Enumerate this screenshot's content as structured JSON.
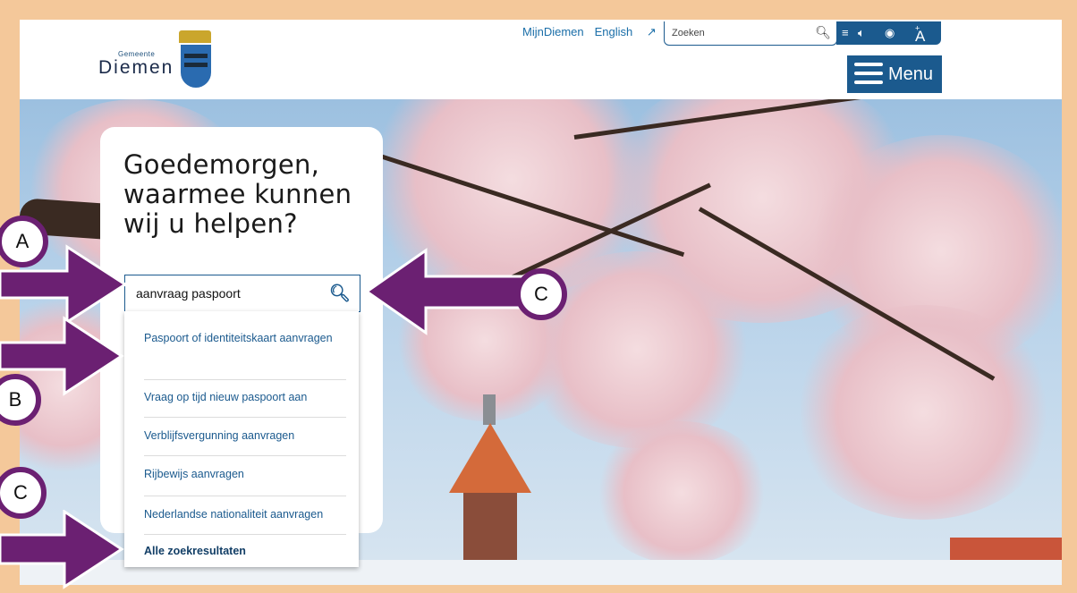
{
  "header": {
    "logo_small": "Gemeente",
    "logo_text": "Diemen",
    "links": [
      "MijnDiemen",
      "English"
    ],
    "search_placeholder": "Zoeken",
    "a11y_font_label": "A",
    "menu_label": "Menu"
  },
  "hero": {
    "greeting": "Goedemorgen, waarmee kunnen wij u helpen?",
    "search_value": "aanvraag paspoort",
    "suggestions": [
      "Paspoort of identiteitskaart aanvragen",
      "Vraag op tijd nieuw paspoort aan",
      "Verblijfsvergunning aanvragen",
      "Rijbewijs aanvragen",
      "Nederlandse nationaliteit aanvragen"
    ],
    "all_results": "Alle zoekresultaten"
  },
  "annotations": {
    "label_a": "A",
    "label_b": "B",
    "label_c_top": "C",
    "label_c_bottom": "C",
    "arrow_color": "#6b2072"
  },
  "colors": {
    "brand_blue": "#1b5a8e",
    "frame": "#f4c89a"
  }
}
